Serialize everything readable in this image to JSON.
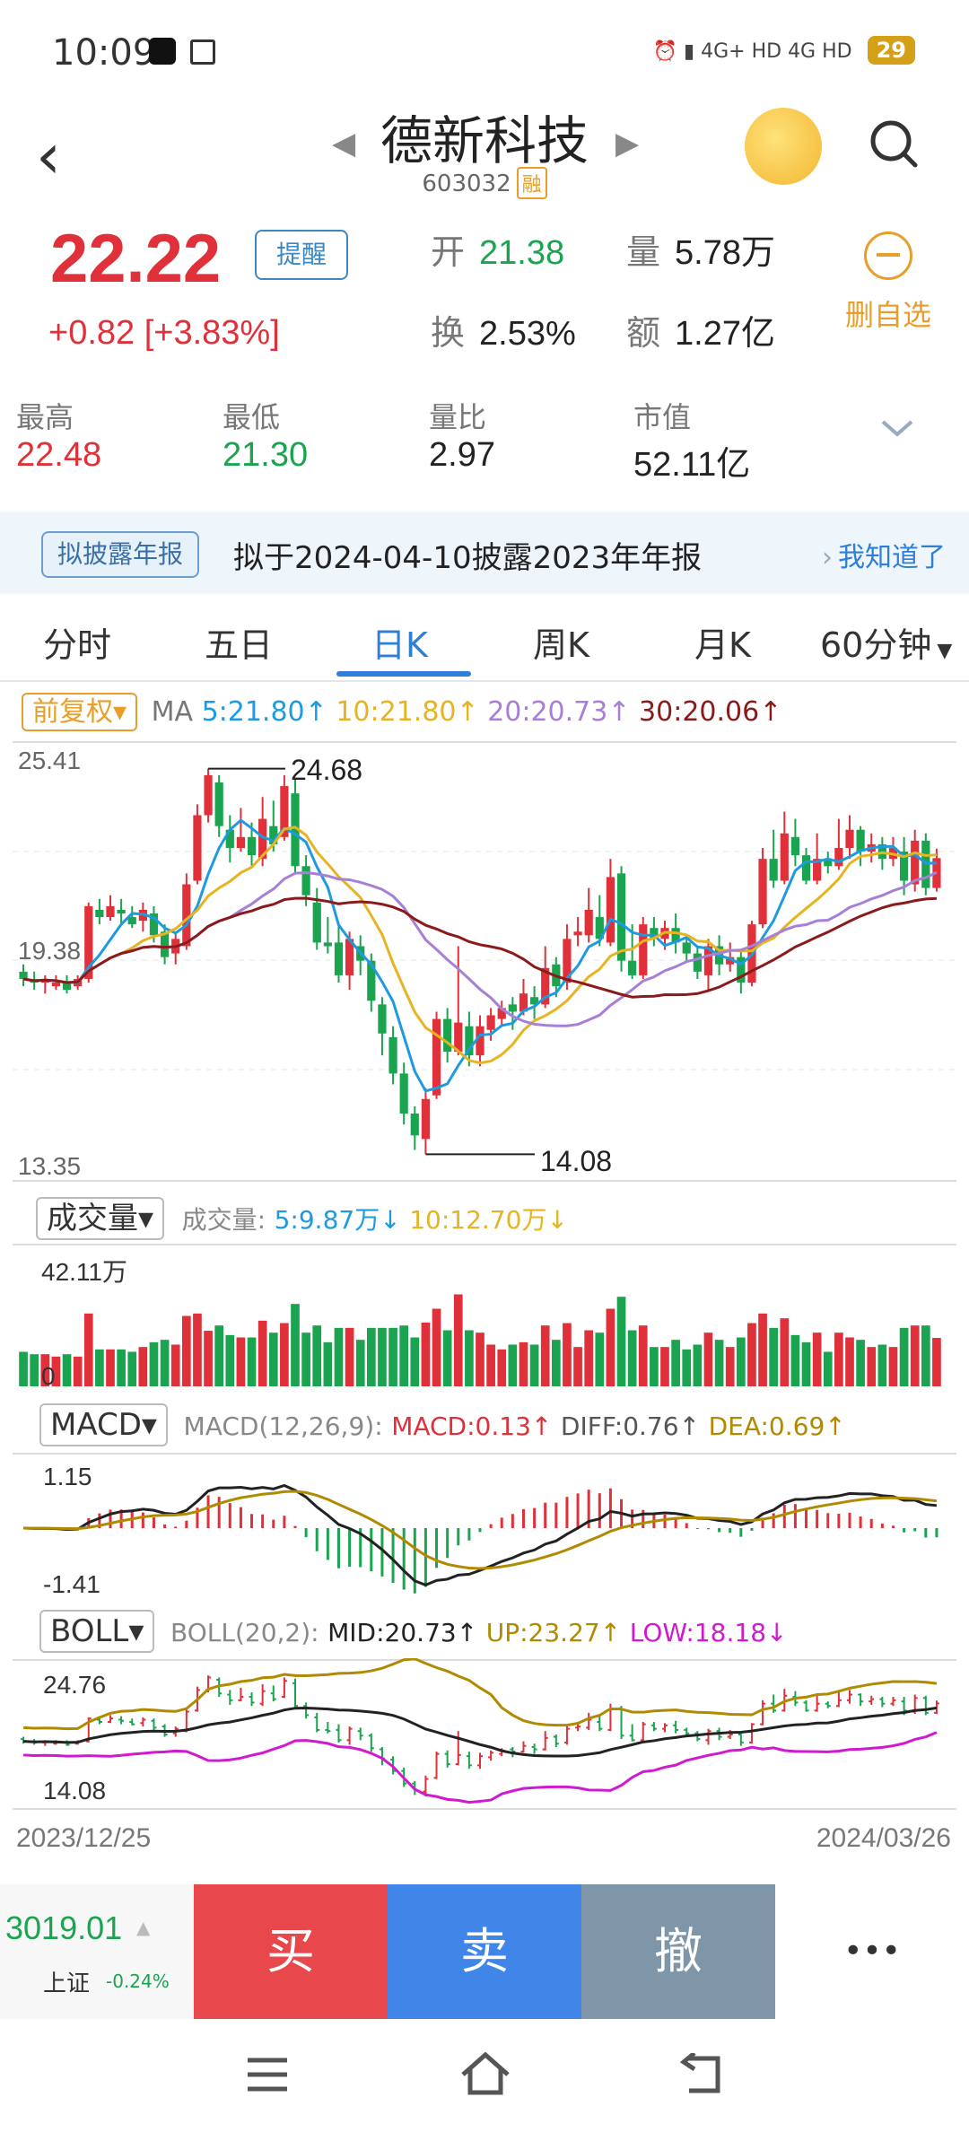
{
  "status": {
    "time": "10:09",
    "network1": "4G+ HD",
    "network2": "4G HD",
    "battery": "29"
  },
  "header": {
    "title": "德新科技",
    "code": "603032",
    "badge": "融"
  },
  "quote": {
    "price": "22.22",
    "remind_label": "提醒",
    "change": "+0.82",
    "change_pct": "[+3.83%]",
    "open_label": "开",
    "open": "21.38",
    "volume_label": "量",
    "volume": "5.78万",
    "turnover_label": "换",
    "turnover": "2.53%",
    "amount_label": "额",
    "amount": "1.27亿",
    "delete_label": "删自选"
  },
  "stats": [
    {
      "label": "最高",
      "value": "22.48"
    },
    {
      "label": "最低",
      "value": "21.30"
    },
    {
      "label": "量比",
      "value": "2.97"
    },
    {
      "label": "市值",
      "value": "52.11亿"
    }
  ],
  "banner": {
    "tag": "拟披露年报",
    "text": "拟于2024-04-10披露2023年年报",
    "link": "我知道了"
  },
  "tabs": [
    "分时",
    "五日",
    "日K",
    "周K",
    "月K",
    "60分钟"
  ],
  "kline": {
    "adjust": "前复权",
    "ma_label": "MA",
    "ma5": "5:21.80",
    "ma10": "10:21.80",
    "ma20": "20:20.73",
    "ma30": "30:20.06",
    "y_top": "25.41",
    "y_mid": "19.38",
    "y_bottom": "13.35",
    "high_mark": "24.68",
    "low_mark": "14.08",
    "colors": {
      "up": "#e0313a",
      "down": "#1ba450",
      "ma5": "#1e9be0",
      "ma10": "#e6b422",
      "ma20": "#a77fd6",
      "ma30": "#8b1a1a"
    }
  },
  "volume": {
    "selector": "成交量",
    "label": "成交量:",
    "ma5": "5:9.87万",
    "ma10": "10:12.70万",
    "y_top": "42.11万",
    "y_zero": "0"
  },
  "macd": {
    "selector": "MACD",
    "params": "MACD(12,26,9):",
    "macd": "MACD:0.13",
    "diff": "DIFF:0.76",
    "dea": "DEA:0.69",
    "y_top": "1.15",
    "y_bottom": "-1.41"
  },
  "boll": {
    "selector": "BOLL",
    "params": "BOLL(20,2):",
    "mid": "MID:20.73",
    "up": "UP:23.27",
    "low": "LOW:18.18",
    "y_top": "24.76",
    "y_bottom": "14.08"
  },
  "dates": {
    "start": "2023/12/25",
    "end": "2024/03/26"
  },
  "bottom": {
    "index_value": "3019.01",
    "index_name": "上证",
    "index_change": "-0.24%",
    "buy": "买",
    "sell": "卖",
    "cancel": "撤",
    "more": "•••"
  },
  "chart_data": {
    "type": "candlestick",
    "candles": [
      [
        19.1,
        18.9,
        19.3,
        18.7
      ],
      [
        18.9,
        18.8,
        19.1,
        18.6
      ],
      [
        18.8,
        18.9,
        19.0,
        18.5
      ],
      [
        18.7,
        18.8,
        19.0,
        18.6
      ],
      [
        18.8,
        18.6,
        19.0,
        18.5
      ],
      [
        18.7,
        18.9,
        19.0,
        18.6
      ],
      [
        18.9,
        20.9,
        21.0,
        18.8
      ],
      [
        20.8,
        20.6,
        21.1,
        20.4
      ],
      [
        20.6,
        20.9,
        21.2,
        20.5
      ],
      [
        20.8,
        20.7,
        21.1,
        20.4
      ],
      [
        20.6,
        20.4,
        20.9,
        20.3
      ],
      [
        20.5,
        20.8,
        21.0,
        20.2
      ],
      [
        20.7,
        20.1,
        20.9,
        19.9
      ],
      [
        20.2,
        19.5,
        20.4,
        19.3
      ],
      [
        19.6,
        20.0,
        20.2,
        19.3
      ],
      [
        19.8,
        21.5,
        21.8,
        19.7
      ],
      [
        21.6,
        23.4,
        23.7,
        21.5
      ],
      [
        23.4,
        24.5,
        24.68,
        23.2
      ],
      [
        24.3,
        23.1,
        24.5,
        22.8
      ],
      [
        23.0,
        22.5,
        23.4,
        22.1
      ],
      [
        22.5,
        22.8,
        23.6,
        22.4
      ],
      [
        22.8,
        22.3,
        23.2,
        22.0
      ],
      [
        22.2,
        23.3,
        23.9,
        22.0
      ],
      [
        23.1,
        22.6,
        23.8,
        22.4
      ],
      [
        22.8,
        24.2,
        24.5,
        22.7
      ],
      [
        24.0,
        22.0,
        24.4,
        21.8
      ],
      [
        22.0,
        21.2,
        22.3,
        20.9
      ],
      [
        21.0,
        19.9,
        21.4,
        19.7
      ],
      [
        19.9,
        19.8,
        20.6,
        19.6
      ],
      [
        19.9,
        19.0,
        20.4,
        18.8
      ],
      [
        19.0,
        20.0,
        20.2,
        18.6
      ],
      [
        19.8,
        19.4,
        20.1,
        19.0
      ],
      [
        19.4,
        18.3,
        19.6,
        18.0
      ],
      [
        18.2,
        17.4,
        18.4,
        16.8
      ],
      [
        17.3,
        16.3,
        17.6,
        16.0
      ],
      [
        16.3,
        15.2,
        16.6,
        14.9
      ],
      [
        15.2,
        14.6,
        15.4,
        14.2
      ],
      [
        14.5,
        15.6,
        15.9,
        14.08
      ],
      [
        15.7,
        17.8,
        18.0,
        15.6
      ],
      [
        17.8,
        16.9,
        18.1,
        16.6
      ],
      [
        16.9,
        17.7,
        19.8,
        16.8
      ],
      [
        17.6,
        16.8,
        18.0,
        16.5
      ],
      [
        16.8,
        17.6,
        17.9,
        16.5
      ],
      [
        17.5,
        17.9,
        18.1,
        17.2
      ],
      [
        17.8,
        18.1,
        18.3,
        17.6
      ],
      [
        18.2,
        18.0,
        18.4,
        17.5
      ],
      [
        18.0,
        18.5,
        18.9,
        17.9
      ],
      [
        18.4,
        18.2,
        18.7,
        17.8
      ],
      [
        18.2,
        19.2,
        19.8,
        18.1
      ],
      [
        19.3,
        18.7,
        19.5,
        18.4
      ],
      [
        18.8,
        20.0,
        20.4,
        18.6
      ],
      [
        20.1,
        20.2,
        20.6,
        19.8
      ],
      [
        20.1,
        20.8,
        21.4,
        19.9
      ],
      [
        20.6,
        20.0,
        21.2,
        19.8
      ],
      [
        19.9,
        21.7,
        22.2,
        19.8
      ],
      [
        21.8,
        19.4,
        22.0,
        19.1
      ],
      [
        19.4,
        19.0,
        20.4,
        18.9
      ],
      [
        19.0,
        20.4,
        20.6,
        18.9
      ],
      [
        20.3,
        20.0,
        20.6,
        19.8
      ],
      [
        20.0,
        20.3,
        20.5,
        19.7
      ],
      [
        20.3,
        19.9,
        20.7,
        19.6
      ],
      [
        19.9,
        19.6,
        20.1,
        19.4
      ],
      [
        19.6,
        19.1,
        19.8,
        18.9
      ],
      [
        19.0,
        19.8,
        20.0,
        18.6
      ],
      [
        19.8,
        19.3,
        20.1,
        19.0
      ],
      [
        19.3,
        19.5,
        19.9,
        19.1
      ],
      [
        19.5,
        18.8,
        19.7,
        18.5
      ],
      [
        18.8,
        20.4,
        20.5,
        18.7
      ],
      [
        20.4,
        22.2,
        22.5,
        20.3
      ],
      [
        22.2,
        21.6,
        23.0,
        21.4
      ],
      [
        21.6,
        22.9,
        23.5,
        21.5
      ],
      [
        22.8,
        22.3,
        23.3,
        22.0
      ],
      [
        22.3,
        21.6,
        22.5,
        21.5
      ],
      [
        21.6,
        22.2,
        22.9,
        21.5
      ],
      [
        22.2,
        22.0,
        22.4,
        21.8
      ],
      [
        22.0,
        22.5,
        23.3,
        21.9
      ],
      [
        22.5,
        23.0,
        23.4,
        22.2
      ],
      [
        23.0,
        22.4,
        23.1,
        22.0
      ],
      [
        22.4,
        22.6,
        22.9,
        22.1
      ],
      [
        22.6,
        22.2,
        22.8,
        21.9
      ],
      [
        22.2,
        22.5,
        22.8,
        22.0
      ],
      [
        22.4,
        21.6,
        22.8,
        21.2
      ],
      [
        21.5,
        22.7,
        23.0,
        21.3
      ],
      [
        22.7,
        21.4,
        22.9,
        21.2
      ],
      [
        21.4,
        22.22,
        22.48,
        21.3
      ]
    ],
    "y_range": [
      13.35,
      25.41
    ]
  }
}
